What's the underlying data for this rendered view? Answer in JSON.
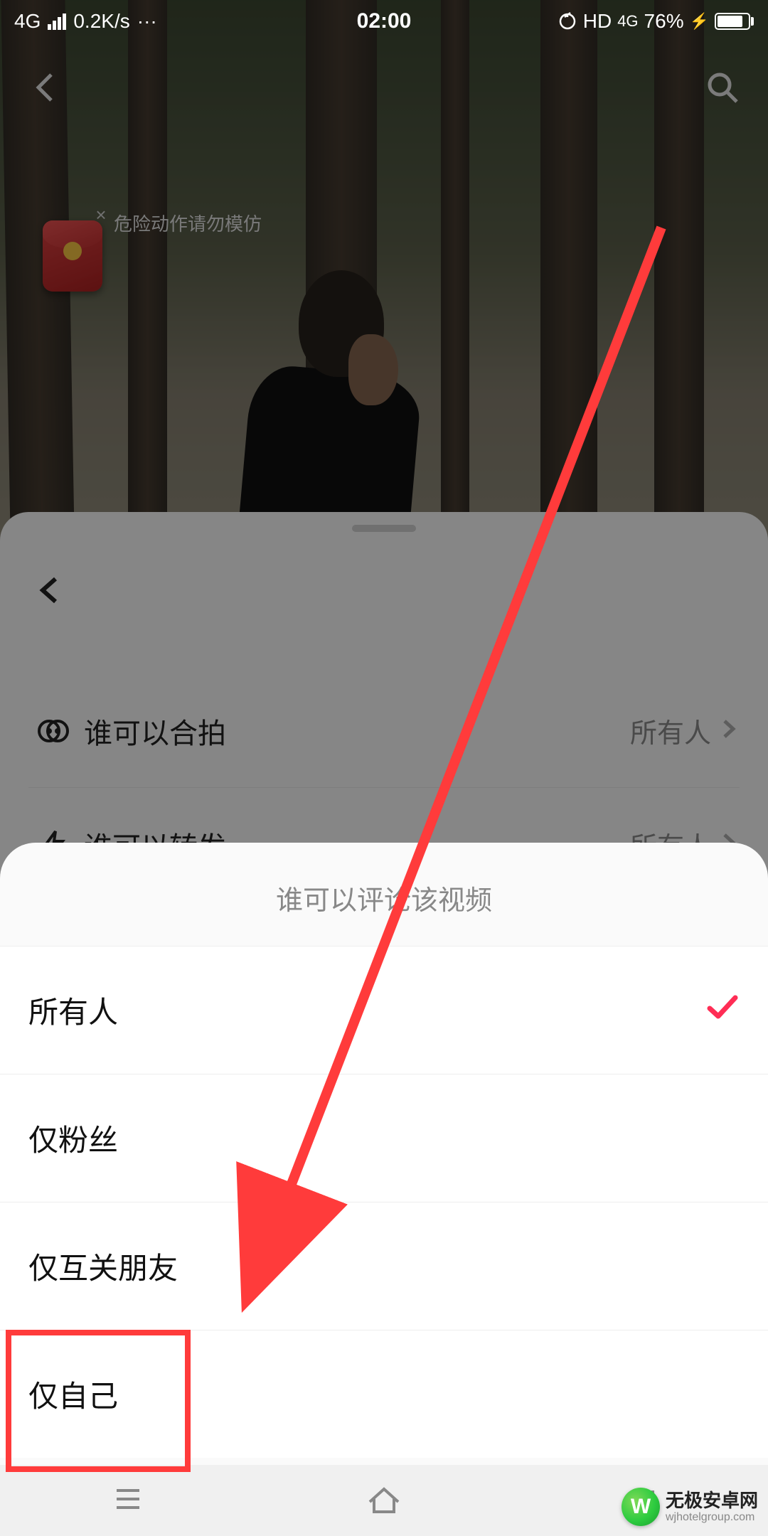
{
  "status_bar": {
    "network_type": "4G",
    "speed": "0.2K/s",
    "dots": "···",
    "time": "02:00",
    "hd_label": "HD",
    "network_type_right": "4G",
    "battery_percent": "76%",
    "charging_icon": "⚡"
  },
  "video_overlay": {
    "warning_text": "危险动作请勿模仿"
  },
  "settings": {
    "items": [
      {
        "icon": "double-circle",
        "label": "谁可以合拍",
        "value": "所有人"
      },
      {
        "icon": "bolt",
        "label": "谁可以转发",
        "value": "所有人"
      }
    ]
  },
  "action_sheet": {
    "title": "谁可以评论该视频",
    "options": [
      {
        "label": "所有人",
        "selected": true
      },
      {
        "label": "仅粉丝",
        "selected": false
      },
      {
        "label": "仅互关朋友",
        "selected": false
      },
      {
        "label": "仅自己",
        "selected": false
      }
    ]
  },
  "watermark": {
    "name": "无极安卓网",
    "domain": "wjhotelgroup.com",
    "logo_letter": "W"
  }
}
